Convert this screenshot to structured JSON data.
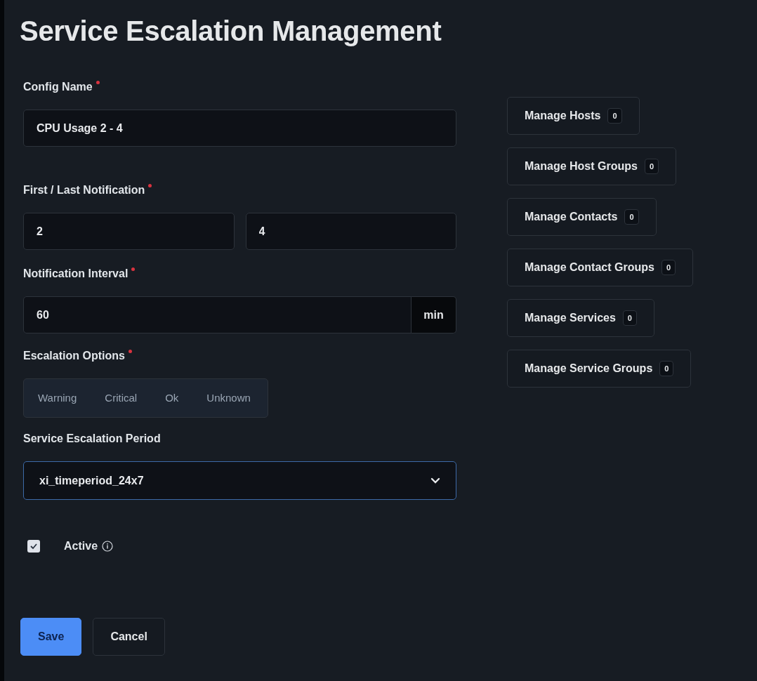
{
  "title": "Service Escalation Management",
  "config_name": {
    "label": "Config Name",
    "required": true,
    "value": "CPU Usage 2 - 4"
  },
  "notification_range": {
    "label": "First / Last Notification",
    "required": true,
    "first": "2",
    "last": "4"
  },
  "notification_interval": {
    "label": "Notification Interval",
    "required": true,
    "value": "60",
    "unit": "min"
  },
  "escalation_options": {
    "label": "Escalation Options",
    "required": true,
    "options": [
      {
        "label": "Warning",
        "selected": false
      },
      {
        "label": "Critical",
        "selected": false
      },
      {
        "label": "Ok",
        "selected": false
      },
      {
        "label": "Unknown",
        "selected": false
      }
    ]
  },
  "escalation_period": {
    "label": "Service Escalation Period",
    "value": "xi_timeperiod_24x7"
  },
  "active": {
    "label": "Active",
    "checked": true
  },
  "manage_buttons": [
    {
      "label": "Manage Hosts",
      "count": "0"
    },
    {
      "label": "Manage Host Groups",
      "count": "0"
    },
    {
      "label": "Manage Contacts",
      "count": "0"
    },
    {
      "label": "Manage Contact Groups",
      "count": "0"
    },
    {
      "label": "Manage Services",
      "count": "0"
    },
    {
      "label": "Manage Service Groups",
      "count": "0"
    }
  ],
  "buttons": [
    {
      "label": "Save",
      "kind": "primary"
    },
    {
      "label": "Cancel",
      "kind": "secondary"
    }
  ]
}
